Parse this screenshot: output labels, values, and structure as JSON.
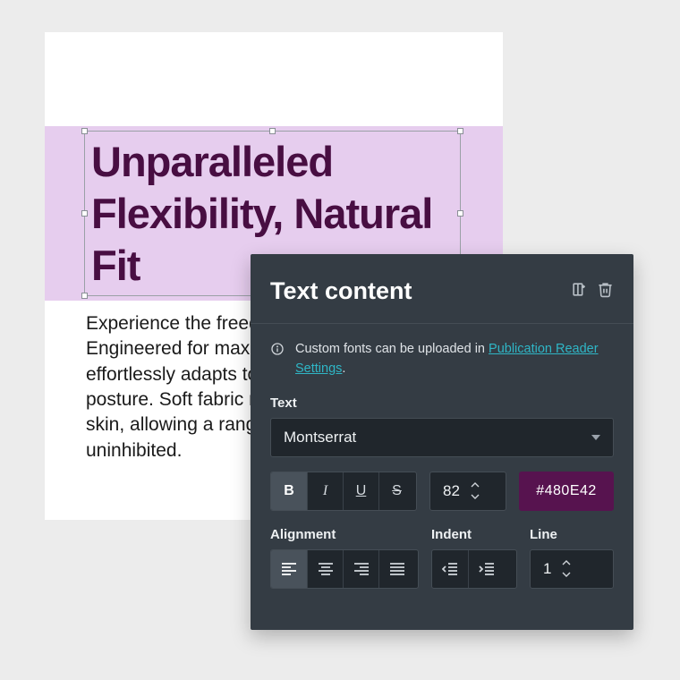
{
  "canvas": {
    "heading": "Unparalleled Flexibility, Natural Fit",
    "body": "Experience the freedom of movement. Engineered for maximum flexibility, clothing effortlessly adapts to every stretch and posture. Soft fabric mimics the natural feel of skin, allowing a range of motion entirely uninhibited.",
    "heading_color": "#480E42"
  },
  "panel": {
    "title": "Text content",
    "info_text_prefix": "Custom fonts can be uploaded in ",
    "info_link": "Publication Reader Settings",
    "info_text_suffix": ".",
    "text_label": "Text",
    "font_value": "Montserrat",
    "styles": {
      "bold": "B",
      "italic": "I",
      "underline": "U",
      "strike": "S"
    },
    "font_size": "82",
    "color_hex": "#480E42",
    "alignment_label": "Alignment",
    "indent_label": "Indent",
    "line_label": "Line",
    "line_value": "1"
  }
}
